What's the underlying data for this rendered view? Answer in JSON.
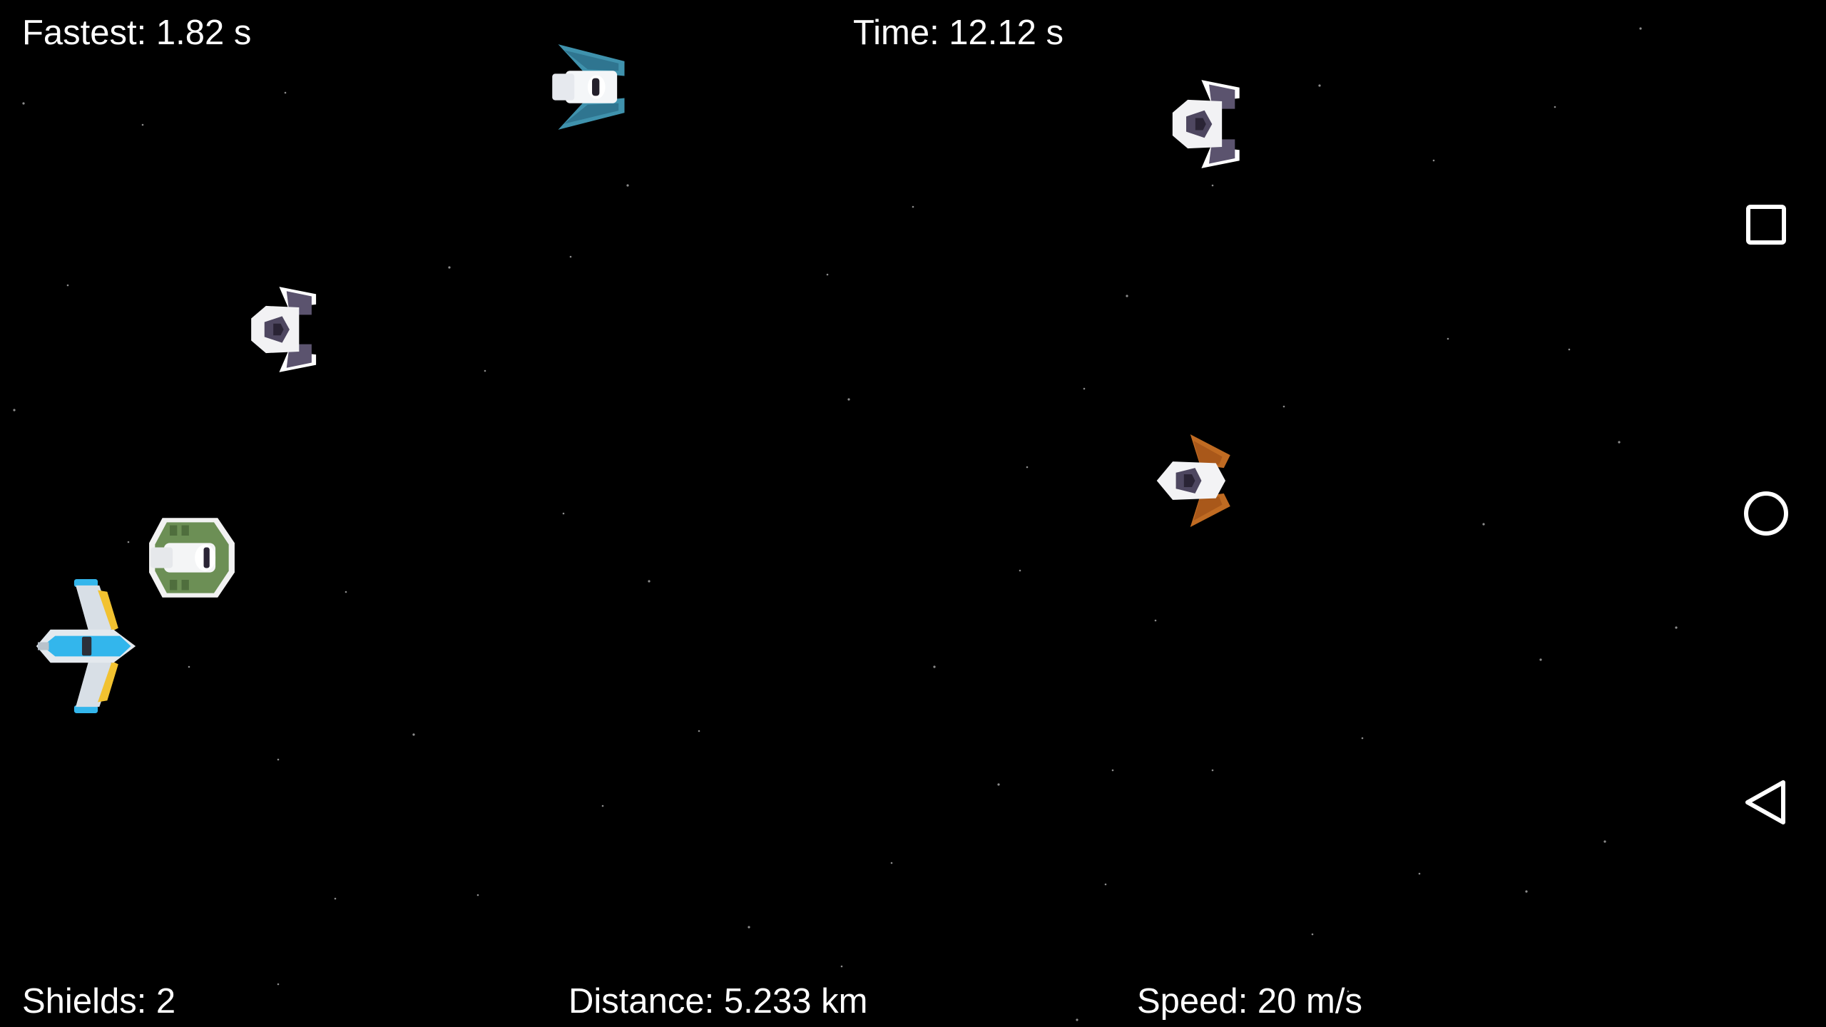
{
  "hud": {
    "fastest": "Fastest: 1.82 s",
    "time": "Time: 12.12 s",
    "shields": "Shields: 2",
    "distance": "Distance: 5.233 km",
    "speed": "Speed: 20 m/s"
  },
  "sprites": {
    "player": {
      "icon": "player-ship-icon",
      "colors": {
        "body": "#d8dfe6",
        "cockpit": "#33b6ec",
        "accent": "#f2c230"
      }
    },
    "enemies": [
      {
        "icon": "enemy-ship-icon",
        "accent": "#3f92ad"
      },
      {
        "icon": "enemy-ship-icon",
        "accent": "#5b536e"
      },
      {
        "icon": "enemy-ship-icon",
        "accent": "#5b536e"
      },
      {
        "icon": "enemy-ship-icon",
        "accent": "#c06b22"
      },
      {
        "icon": "enemy-ship-icon",
        "accent": "#6c8f55"
      }
    ]
  },
  "nav": {
    "recents": {
      "icon": "square-icon"
    },
    "home": {
      "icon": "circle-icon"
    },
    "back": {
      "icon": "triangle-back-icon"
    }
  }
}
